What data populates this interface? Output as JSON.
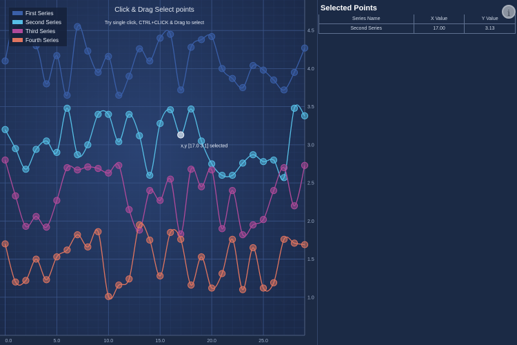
{
  "chart_data": {
    "type": "line",
    "title": "Click & Drag Select points",
    "subtitle": "Try single click, CTRL+CLICK & Drag to select",
    "x": [
      0,
      1.5,
      3,
      4.5,
      6,
      7.5,
      9,
      10.5,
      12,
      13.5,
      15,
      16.5,
      18,
      19.5,
      21,
      22.5,
      24,
      25.5,
      27,
      28.5
    ],
    "xlim": [
      -0.5,
      29
    ],
    "ylim": [
      0.5,
      4.9
    ],
    "x_ticks": [
      "0.0",
      "5.0",
      "10.0",
      "15.0",
      "20.0",
      "25.0"
    ],
    "y_ticks": [
      "1.0",
      "1.5",
      "2.0",
      "2.5",
      "3.0",
      "3.5",
      "4.0",
      "4.5"
    ],
    "grid": true,
    "legend_position": "top-left",
    "series": [
      {
        "name": "First Series",
        "color": "#3a5fa8",
        "points": [
          [
            0,
            4.1
          ],
          [
            1,
            4.6
          ],
          [
            3,
            4.3
          ],
          [
            4,
            3.8
          ],
          [
            5,
            4.17
          ],
          [
            6,
            3.65
          ],
          [
            7,
            4.55
          ],
          [
            8,
            4.23
          ],
          [
            9,
            3.95
          ],
          [
            10,
            4.16
          ],
          [
            11,
            3.65
          ],
          [
            12,
            3.9
          ],
          [
            13,
            4.26
          ],
          [
            14,
            4.1
          ],
          [
            15,
            4.4
          ],
          [
            16,
            4.45
          ],
          [
            17,
            3.72
          ],
          [
            18,
            4.28
          ],
          [
            19,
            4.38
          ],
          [
            20,
            4.42
          ],
          [
            21,
            4.0
          ],
          [
            22,
            3.87
          ],
          [
            23,
            3.75
          ],
          [
            24,
            4.04
          ],
          [
            25,
            3.98
          ],
          [
            26,
            3.85
          ],
          [
            27,
            3.72
          ],
          [
            28,
            3.95
          ],
          [
            29,
            4.27
          ]
        ]
      },
      {
        "name": "Second Series",
        "color": "#56bfe6",
        "points": [
          [
            0,
            3.2
          ],
          [
            1,
            2.95
          ],
          [
            2,
            2.68
          ],
          [
            3,
            2.94
          ],
          [
            4,
            3.05
          ],
          [
            5,
            2.9
          ],
          [
            6,
            3.48
          ],
          [
            7,
            2.87
          ],
          [
            8,
            3.0
          ],
          [
            9,
            3.4
          ],
          [
            10,
            3.4
          ],
          [
            11,
            3.04
          ],
          [
            12,
            3.4
          ],
          [
            13,
            3.12
          ],
          [
            14,
            2.6
          ],
          [
            15,
            3.28
          ],
          [
            16,
            3.46
          ],
          [
            17,
            3.13
          ],
          [
            18,
            3.47
          ],
          [
            19,
            3.05
          ],
          [
            20,
            2.75
          ],
          [
            21,
            2.6
          ],
          [
            22,
            2.6
          ],
          [
            23,
            2.76
          ],
          [
            24,
            2.87
          ],
          [
            25,
            2.78
          ],
          [
            26,
            2.8
          ],
          [
            27,
            2.57
          ],
          [
            28,
            3.48
          ],
          [
            29,
            3.38
          ]
        ]
      },
      {
        "name": "Third Series",
        "color": "#b04a9a",
        "points": [
          [
            0,
            2.8
          ],
          [
            1,
            2.33
          ],
          [
            2,
            1.93
          ],
          [
            3,
            2.06
          ],
          [
            4,
            1.92
          ],
          [
            5,
            2.27
          ],
          [
            6,
            2.7
          ],
          [
            7,
            2.67
          ],
          [
            8,
            2.71
          ],
          [
            9,
            2.69
          ],
          [
            10,
            2.63
          ],
          [
            11,
            2.73
          ],
          [
            12,
            2.15
          ],
          [
            13,
            1.88
          ],
          [
            14,
            2.4
          ],
          [
            15,
            2.27
          ],
          [
            16,
            2.55
          ],
          [
            17,
            1.83
          ],
          [
            18,
            2.68
          ],
          [
            19,
            2.45
          ],
          [
            20,
            2.67
          ],
          [
            21,
            1.9
          ],
          [
            22,
            2.4
          ],
          [
            23,
            1.82
          ],
          [
            24,
            1.95
          ],
          [
            25,
            2.02
          ],
          [
            26,
            2.4
          ],
          [
            27,
            2.7
          ],
          [
            28,
            2.2
          ],
          [
            29,
            2.73
          ]
        ]
      },
      {
        "name": "Fourth Series",
        "color": "#e07560",
        "points": [
          [
            0,
            1.7
          ],
          [
            1,
            1.2
          ],
          [
            2,
            1.22
          ],
          [
            3,
            1.5
          ],
          [
            4,
            1.23
          ],
          [
            5,
            1.53
          ],
          [
            6,
            1.62
          ],
          [
            7,
            1.82
          ],
          [
            8,
            1.66
          ],
          [
            9,
            1.86
          ],
          [
            10,
            1.01
          ],
          [
            11,
            1.16
          ],
          [
            12,
            1.24
          ],
          [
            13,
            1.95
          ],
          [
            14,
            1.75
          ],
          [
            15,
            1.28
          ],
          [
            16,
            1.85
          ],
          [
            17,
            1.76
          ],
          [
            18,
            1.16
          ],
          [
            19,
            1.53
          ],
          [
            20,
            1.12
          ],
          [
            21,
            1.31
          ],
          [
            22,
            1.76
          ],
          [
            23,
            1.1
          ],
          [
            24,
            1.65
          ],
          [
            25,
            1.12
          ],
          [
            26,
            1.19
          ],
          [
            27,
            1.76
          ],
          [
            28,
            1.71
          ],
          [
            29,
            1.69
          ]
        ]
      }
    ],
    "selected_point": {
      "series": "Second Series",
      "x": 17.0,
      "y": 3.13
    },
    "annotation": "x,y [17.0 3.1] selected"
  },
  "panel": {
    "title": "Selected Points",
    "info_icon": "i",
    "columns": [
      "Series Name",
      "X Value",
      "Y Value"
    ],
    "rows": [
      [
        "Second Series",
        "17.00",
        "3.13"
      ]
    ]
  }
}
